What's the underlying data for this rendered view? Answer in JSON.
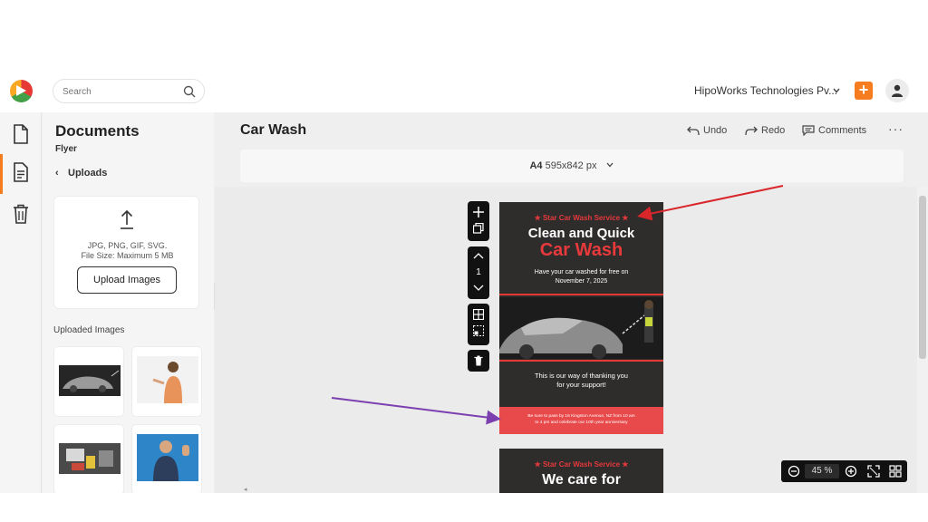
{
  "topbar": {
    "search_placeholder": "Search",
    "org_name": "HipoWorks Technologies Pv...",
    "add_label": "+"
  },
  "sidebar": {
    "items": [
      {
        "icon": "document-icon"
      },
      {
        "icon": "document-text-icon",
        "active": true
      },
      {
        "icon": "trash-icon"
      }
    ]
  },
  "panel": {
    "title": "Documents",
    "subtitle": "Flyer",
    "back_label": "Uploads",
    "formats": "JPG, PNG, GIF, SVG.",
    "max_size": "File Size: Maximum 5 MB",
    "upload_button": "Upload Images",
    "uploaded_label": "Uploaded Images"
  },
  "document": {
    "title": "Car Wash",
    "undo": "Undo",
    "redo": "Redo",
    "comments": "Comments",
    "more": "···",
    "page_format": "A4",
    "page_size": "595x842 px"
  },
  "page_toolbar": {
    "page_number": "1"
  },
  "flyer": {
    "brand": "★  Star Car Wash Service  ★",
    "headline": "Clean and Quick",
    "headline2": "Car Wash",
    "offer_line1": "Have your car washed for free on",
    "offer_line2": "November 7, 2025",
    "thanks_line1": "This is our way of thanking you",
    "thanks_line2": "for your support!",
    "band_line1": "Be sure to pass by 16 Kingston Avenue, NZ from 10 am",
    "band_line2": "to 4 pm and celebrate our 10th year anniversary"
  },
  "flyer_page2": {
    "brand": "★  Star Car Wash Service  ★",
    "headline": "We care for"
  },
  "zoom": {
    "value": "45 %"
  },
  "colors": {
    "accent": "#f57c1f",
    "flyer_bg": "#2f2c2c",
    "flyer_red": "#e8393c",
    "annotation_red": "#d9262b",
    "annotation_purple": "#7b3fb0"
  }
}
